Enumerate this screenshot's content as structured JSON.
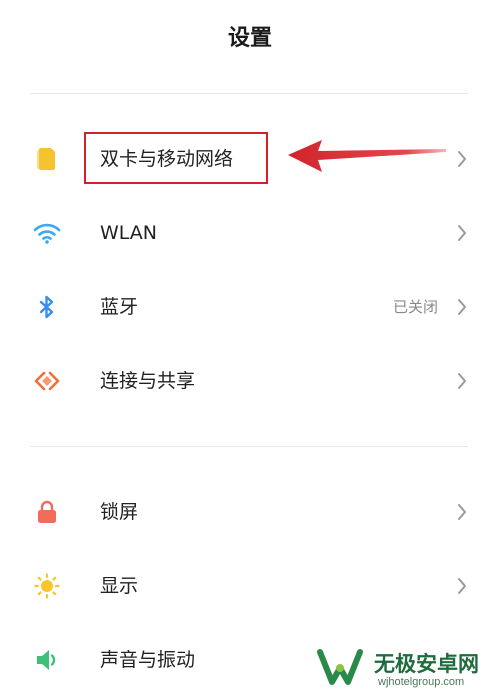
{
  "header": {
    "title": "设置"
  },
  "section1": {
    "items": [
      {
        "label": "双卡与移动网络",
        "icon": "sim-card-icon",
        "color": "#f5c330"
      },
      {
        "label": "WLAN",
        "icon": "wifi-icon",
        "color": "#3aaaf0"
      },
      {
        "label": "蓝牙",
        "icon": "bluetooth-icon",
        "color": "#3a8fe8",
        "status": "已关闭"
      },
      {
        "label": "连接与共享",
        "icon": "share-connect-icon",
        "color": "#f0703a"
      }
    ]
  },
  "section2": {
    "items": [
      {
        "label": "锁屏",
        "icon": "lock-icon",
        "color": "#f26b5b"
      },
      {
        "label": "显示",
        "icon": "sun-icon",
        "color": "#f8c52a"
      },
      {
        "label": "声音与振动",
        "icon": "speaker-icon",
        "color": "#3cc07a"
      }
    ]
  },
  "annotation": {
    "highlight_color": "#d2232a",
    "arrow_color": "#d2232a"
  },
  "watermark": {
    "main": "无极安卓网",
    "sub": "wjhotelgroup.com"
  }
}
